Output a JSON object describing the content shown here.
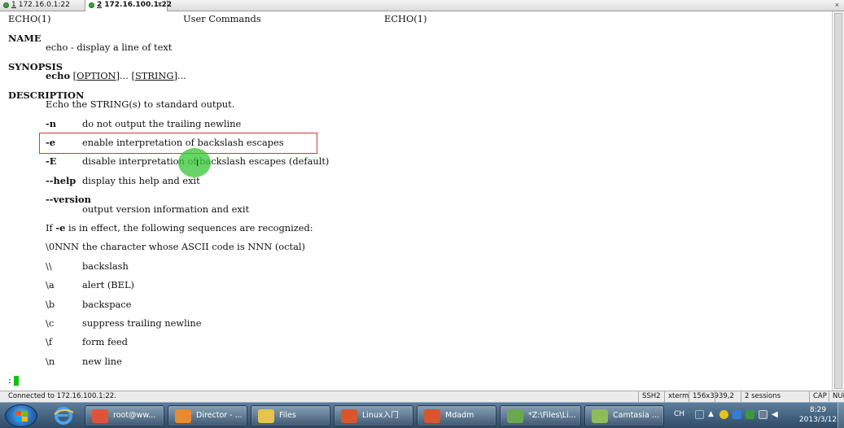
{
  "tabs": [
    {
      "num": "1",
      "label": "172.16.0.1:22",
      "active": false
    },
    {
      "num": "2",
      "label": "172.16.100.1:22",
      "active": true
    }
  ],
  "tab_close_glyph": "×",
  "terminal": {
    "header_left": "ECHO(1)",
    "header_center": "User Commands",
    "header_right": "ECHO(1)",
    "name_heading": "NAME",
    "name_text": "echo - display a line of text",
    "synopsis_heading": "SYNOPSIS",
    "synopsis_cmd": "echo",
    "synopsis_option": "OPTION",
    "synopsis_string": "STRING",
    "synopsis_ellipsis": "...",
    "description_heading": "DESCRIPTION",
    "description_text": "Echo the STRING(s) to standard output.",
    "options": [
      {
        "flag": "-n",
        "text": "do not output the trailing newline"
      },
      {
        "flag": "-e",
        "text": "enable interpretation of backslash escapes"
      },
      {
        "flag": "-E",
        "text": "disable interpretation of backslash escapes (default)"
      },
      {
        "flag": "--help",
        "text": "display this help and exit"
      },
      {
        "flag": "--version",
        "text": "output version information and exit"
      }
    ],
    "if_prefix": "If ",
    "if_flag": "-e",
    "if_suffix": " is in effect, the following sequences are recognized:",
    "sequences": [
      {
        "code": "\\0NNN",
        "text": "the character whose ASCII code is NNN (octal)"
      },
      {
        "code": "\\\\",
        "text": "backslash"
      },
      {
        "code": "\\a",
        "text": "alert (BEL)"
      },
      {
        "code": "\\b",
        "text": "backspace"
      },
      {
        "code": "\\c",
        "text": "suppress trailing newline"
      },
      {
        "code": "\\f",
        "text": "form feed"
      },
      {
        "code": "\\n",
        "text": "new line"
      }
    ],
    "prompt": ":"
  },
  "status": {
    "connection": "Connected to 172.16.100.1:22.",
    "protocol": "SSH2",
    "terminal_type": "xterm",
    "size": "156x39",
    "position": "39,2",
    "sessions": "2 sessions",
    "caps": "CAP",
    "num": "NUM"
  },
  "taskbar": {
    "items": [
      {
        "label": "root@ww...",
        "icon_color": "#e0533a"
      },
      {
        "label": "Director - ...",
        "icon_color": "#e88a2e"
      },
      {
        "label": "Files",
        "icon_color": "#e7c34a"
      },
      {
        "label": "Linux入门",
        "icon_color": "#d9552c"
      },
      {
        "label": "Mdadm",
        "icon_color": "#d9552c"
      },
      {
        "label": "*Z:\\Files\\Li...",
        "icon_color": "#6aa84f"
      },
      {
        "label": "Camtasia ...",
        "icon_color": "#8fbc5a"
      }
    ],
    "ime": "CH",
    "time": "8:29",
    "date": "2013/3/12"
  }
}
